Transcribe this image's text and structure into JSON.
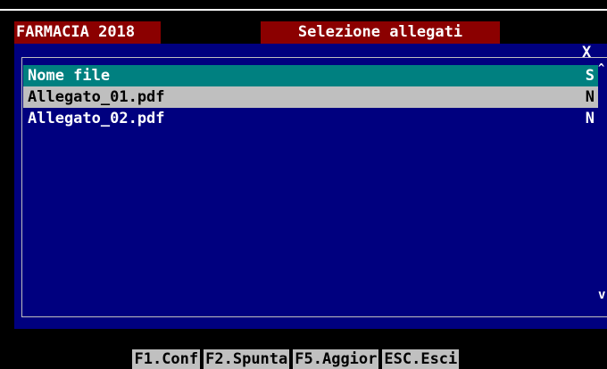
{
  "header": {
    "app_title": "FARMACIA 2018",
    "dialog_title": "Selezione allegati"
  },
  "dialog": {
    "close_glyph": "X"
  },
  "list": {
    "column_header": {
      "name": "Nome file",
      "flag": "S"
    },
    "rows": [
      {
        "name": "Allegato_01.pdf",
        "flag": "N"
      },
      {
        "name": "Allegato_02.pdf",
        "flag": "N"
      }
    ]
  },
  "scrollbar": {
    "up_glyph": "^",
    "down_glyph": "v"
  },
  "function_keys": [
    {
      "label": "F1.Conf"
    },
    {
      "label": "F2.Spunta"
    },
    {
      "label": "F5.Aggior"
    },
    {
      "label": "ESC.Esci"
    }
  ],
  "colors": {
    "panel": "#00007f",
    "title_bg": "#8b0000",
    "header_row": "#008080",
    "selected_row": "#bfbfbf"
  }
}
